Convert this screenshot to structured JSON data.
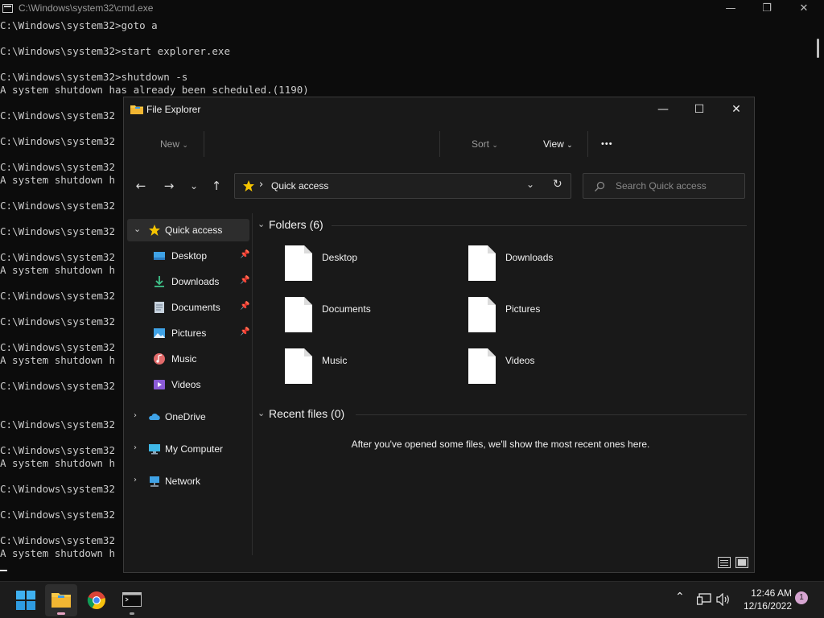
{
  "cmd": {
    "title": "C:\\Windows\\system32\\cmd.exe",
    "controls": {
      "minimize": "—",
      "maximize": "❐",
      "close": "✕"
    },
    "lines": [
      "C:\\Windows\\system32>goto a",
      "",
      "C:\\Windows\\system32>start explorer.exe",
      "",
      "C:\\Windows\\system32>shutdown -s",
      "A system shutdown has already been scheduled.(1190)",
      "",
      "C:\\Windows\\system32",
      "",
      "C:\\Windows\\system32",
      "",
      "C:\\Windows\\system32",
      "A system shutdown h",
      "",
      "C:\\Windows\\system32",
      "",
      "C:\\Windows\\system32",
      "",
      "C:\\Windows\\system32",
      "A system shutdown h",
      "",
      "C:\\Windows\\system32",
      "",
      "C:\\Windows\\system32",
      "",
      "C:\\Windows\\system32",
      "A system shutdown h",
      "",
      "C:\\Windows\\system32",
      "",
      "",
      "C:\\Windows\\system32",
      "",
      "C:\\Windows\\system32",
      "A system shutdown h",
      "",
      "C:\\Windows\\system32",
      "",
      "C:\\Windows\\system32",
      "",
      "C:\\Windows\\system32",
      "A system shutdown h"
    ]
  },
  "explorer": {
    "title": "File Explorer",
    "controls": {
      "minimize": "—",
      "maximize": "☐",
      "close": "✕"
    },
    "commandbar": {
      "new_label": "New",
      "sort_label": "Sort",
      "view_label": "View",
      "more_label": "•••"
    },
    "nav": {
      "back": "←",
      "forward": "→",
      "recent": "⌄",
      "up": "↑",
      "refresh": "↻"
    },
    "address": {
      "location": "Quick access",
      "separator": "›"
    },
    "search": {
      "placeholder": "Search Quick access"
    },
    "sidebar": {
      "items": [
        {
          "label": "Quick access",
          "icon": "star-icon"
        },
        {
          "label": "Desktop",
          "icon": "desktop-icon",
          "pinned": true
        },
        {
          "label": "Downloads",
          "icon": "download-icon",
          "pinned": true
        },
        {
          "label": "Documents",
          "icon": "documents-icon",
          "pinned": true
        },
        {
          "label": "Pictures",
          "icon": "pictures-icon",
          "pinned": true
        },
        {
          "label": "Music",
          "icon": "music-icon"
        },
        {
          "label": "Videos",
          "icon": "videos-icon"
        },
        {
          "label": "OneDrive",
          "icon": "cloud-icon"
        },
        {
          "label": "My Computer",
          "icon": "computer-icon"
        },
        {
          "label": "Network",
          "icon": "network-icon"
        }
      ]
    },
    "folders_header": "Folders (6)",
    "folders": [
      "Desktop",
      "Downloads",
      "Documents",
      "Pictures",
      "Music",
      "Videos"
    ],
    "recent_header": "Recent files (0)",
    "recent_message": "After you've opened some files, we'll show the most recent ones here."
  },
  "taskbar": {
    "clock_time": "12:46 AM",
    "clock_date": "12/16/2022",
    "notification_count": "1",
    "apps": [
      "start-icon",
      "file-explorer-icon",
      "chrome-icon",
      "terminal-icon"
    ]
  },
  "colors": {
    "accent_star": "#f5c400",
    "notif_badge": "#d6a5d1",
    "folder_yellow": "#f7c948"
  }
}
